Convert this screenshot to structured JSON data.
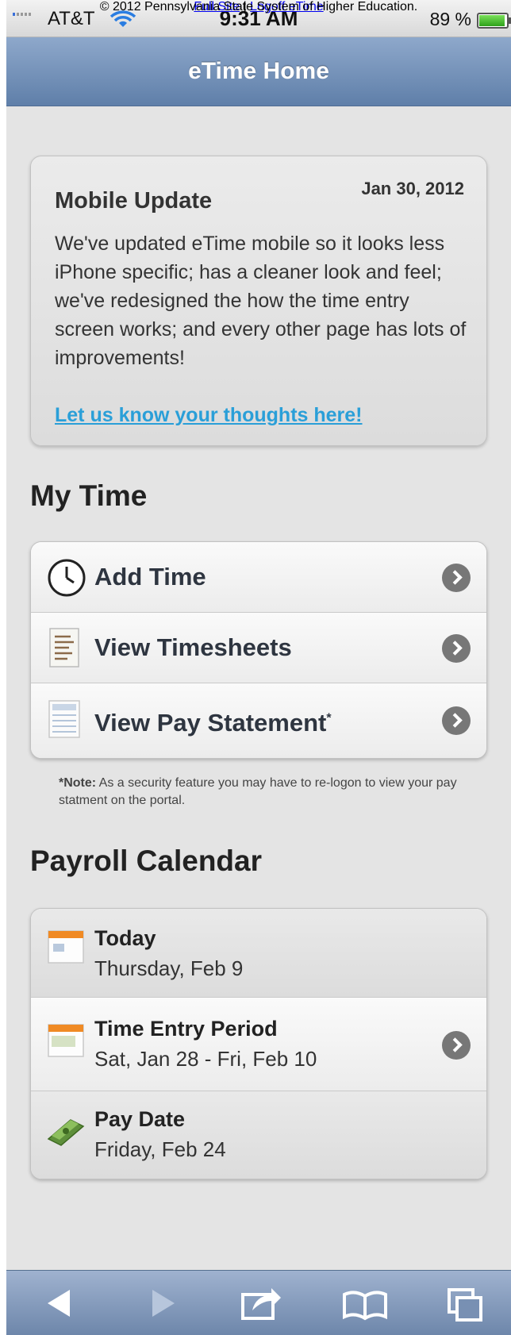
{
  "status": {
    "carrier": "AT&T",
    "time": "9:31 AM",
    "battery": "89 %",
    "battery_level": 0.89
  },
  "header": {
    "title": "eTime Home"
  },
  "announcement": {
    "date": "Jan 30, 2012",
    "title": "Mobile Update",
    "body": "We've updated eTime mobile so it looks less iPhone specific; has a cleaner look and feel; we've redesigned the how the time entry screen works; and every other page has lots of improvements!",
    "link": "Let us know your thoughts here!"
  },
  "my_time": {
    "title": "My Time",
    "items": [
      {
        "label": "Add Time",
        "icon": "clock-icon"
      },
      {
        "label": "View Timesheets",
        "icon": "timesheet-icon"
      },
      {
        "label": "View Pay Statement",
        "mark": "*",
        "icon": "pay-statement-icon"
      }
    ],
    "note_label": "*Note:",
    "note_text": " As a security feature you may have to re-logon to view your pay statment on the portal."
  },
  "payroll": {
    "title": "Payroll Calendar",
    "items": [
      {
        "title": "Today",
        "value": "Thursday, Feb 9",
        "icon": "calendar-icon"
      },
      {
        "title": "Time Entry Period",
        "value": "Sat, Jan 28 - Fri, Feb 10",
        "icon": "calendar-icon"
      },
      {
        "title": "Pay Date",
        "value": "Friday, Feb 24",
        "icon": "money-icon"
      }
    ]
  },
  "footer": {
    "full_site": "Full Site",
    "separator": " | ",
    "logoff": "Logoff eTime",
    "copyright": "© 2012 Pennsylvania State System of Higher Education."
  },
  "toolbar": {
    "icons": [
      "back-icon",
      "forward-icon",
      "share-icon",
      "bookmarks-icon",
      "tabs-icon"
    ]
  }
}
